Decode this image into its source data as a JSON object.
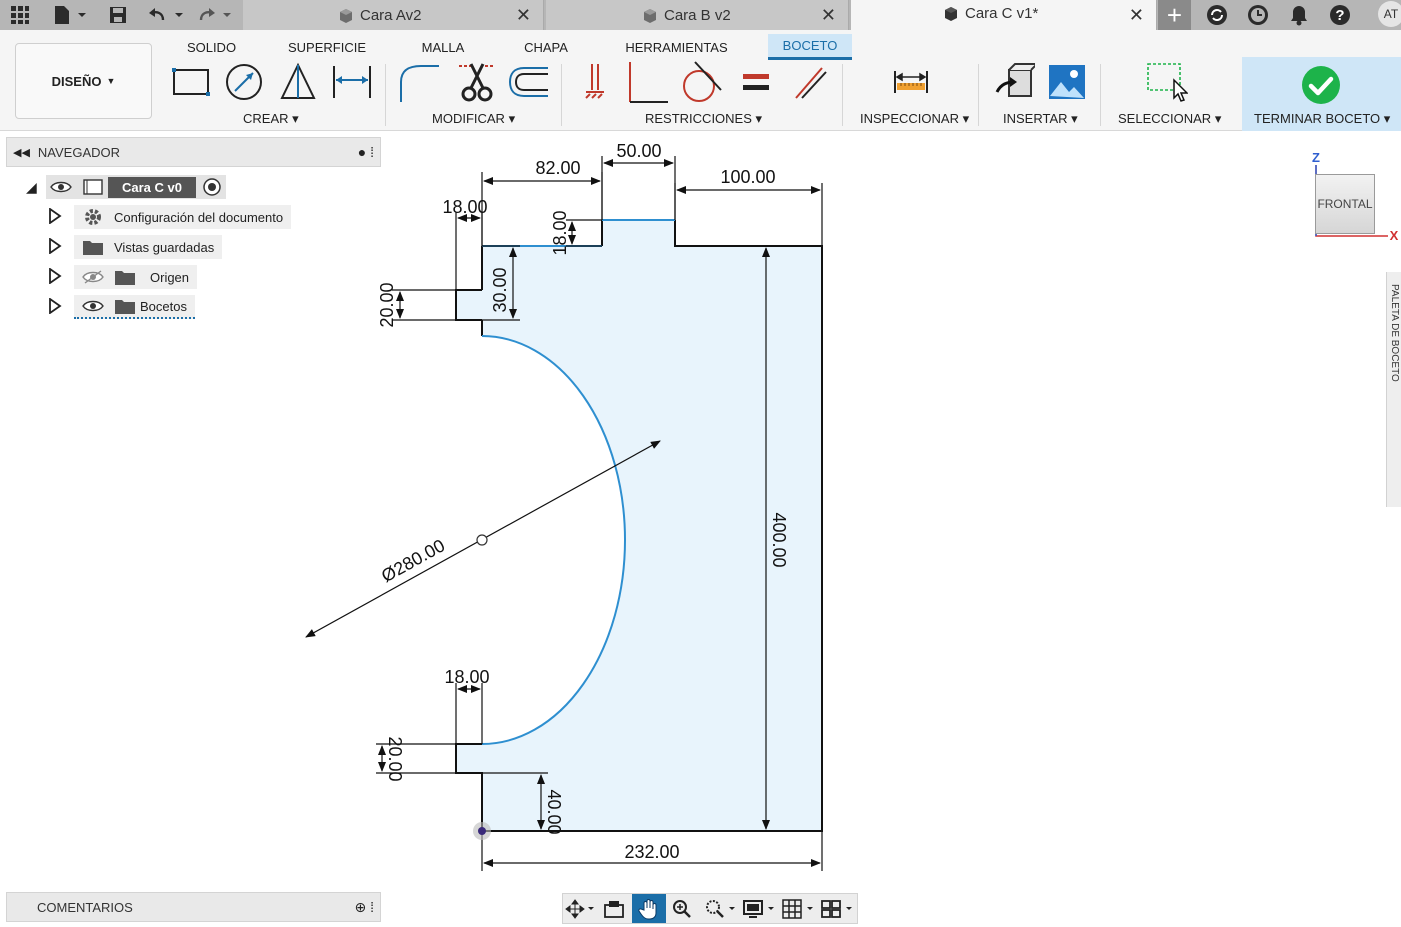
{
  "topbar": {
    "tabs": [
      {
        "label": "Cara Av2",
        "active": false
      },
      {
        "label": "Cara B v2",
        "active": false
      },
      {
        "label": "Cara C v1*",
        "active": true
      }
    ],
    "close_glyph": "✕",
    "avatar": "AT",
    "icons": [
      "apps-grid-icon",
      "file-icon",
      "save-icon",
      "undo-icon",
      "redo-icon",
      "add-tab-icon",
      "sync-icon",
      "history-icon",
      "notifications-icon",
      "help-icon"
    ]
  },
  "ribbon": {
    "workspace": "DISEÑO",
    "tabs": [
      "SOLIDO",
      "SUPERFICIE",
      "MALLA",
      "CHAPA",
      "HERRAMIENTAS",
      "BOCETO"
    ],
    "active_tab": "BOCETO",
    "groups": {
      "crear": "CREAR",
      "modificar": "MODIFICAR",
      "restricciones": "RESTRICCIONES",
      "inspeccionar": "INSPECCIONAR",
      "insertar": "INSERTAR",
      "seleccionar": "SELECCIONAR",
      "terminar": "TERMINAR BOCETO"
    },
    "accent": "#1b6ea8",
    "finish_color": "#1db34a"
  },
  "navigator": {
    "title": "NAVEGADOR",
    "root": "Cara C v0",
    "items": [
      {
        "label": "Configuración del documento",
        "icon": "gear-icon"
      },
      {
        "label": "Vistas guardadas",
        "icon": "folder-icon"
      },
      {
        "label": "Origen",
        "icon": "folder-icon",
        "hidden": true
      },
      {
        "label": "Bocetos",
        "icon": "folder-icon"
      }
    ]
  },
  "comments": {
    "title": "COMENTARIOS"
  },
  "sketch": {
    "profile_fill": "#e8f4fc",
    "curve_color": "#2e8fd0",
    "dimensions": {
      "w82": "82.00",
      "w50": "50.00",
      "w100": "100.00",
      "w18_top": "18.00",
      "h18": "18.00",
      "h30": "30.00",
      "h20_top": "20.00",
      "h400": "400.00",
      "diameter": "Ø280.00",
      "w18_bottom": "18.00",
      "h20_bottom": "20.00",
      "h40": "40.00",
      "w232": "232.00"
    }
  },
  "viewcube": {
    "face": "FRONTAL",
    "axis_z": "Z",
    "axis_x": "X"
  },
  "palette": {
    "label": "PALETA DE BOCETO"
  }
}
